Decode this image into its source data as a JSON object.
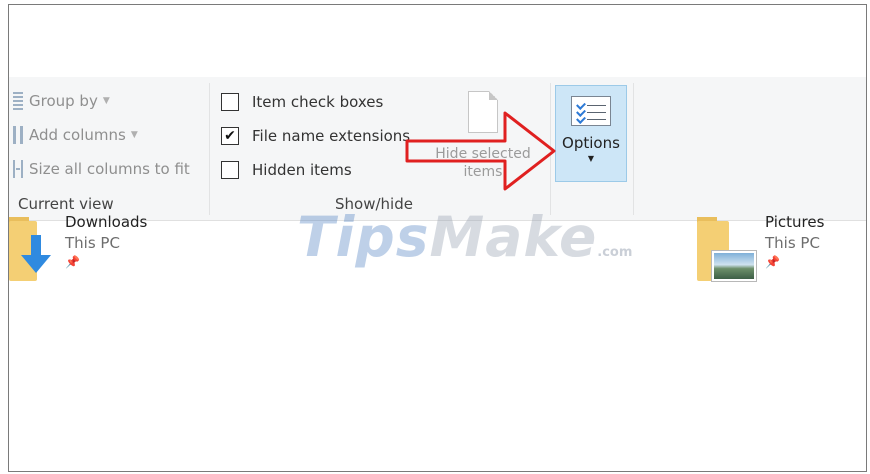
{
  "ribbon": {
    "current_view": {
      "group_by": "Group by",
      "add_columns": "Add columns",
      "size_columns": "Size all columns to fit",
      "label": "Current view"
    },
    "show_hide": {
      "item_check_boxes": {
        "label": "Item check boxes",
        "checked": false
      },
      "file_name_extensions": {
        "label": "File name extensions",
        "checked": true
      },
      "hidden_items": {
        "label": "Hidden items",
        "checked": false
      },
      "hide_selected_line1": "Hide selected",
      "hide_selected_line2": "items",
      "label": "Show/hide"
    },
    "options": {
      "label": "Options",
      "icon": "options-list-icon"
    }
  },
  "files": [
    {
      "name": "Downloads",
      "location": "This PC",
      "icon": "downloads-folder-icon",
      "pinned": true
    },
    {
      "name": "Pictures",
      "location": "This PC",
      "icon": "pictures-folder-icon",
      "pinned": true
    }
  ],
  "watermark": {
    "part1": "Tips",
    "part2": "Make",
    "suffix": ".com"
  },
  "colors": {
    "ribbon_bg": "#f5f6f7",
    "options_highlight": "#cde6f7",
    "arrow_red": "#e02020",
    "folder_yellow": "#f4cf74"
  }
}
